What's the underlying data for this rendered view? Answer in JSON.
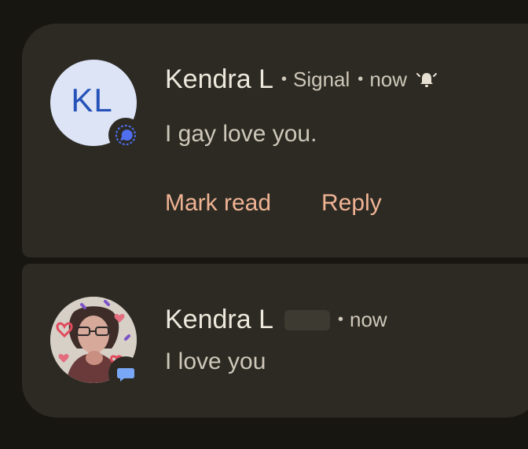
{
  "notifications": [
    {
      "avatar_initials": "KL",
      "sender": "Kendra L",
      "app": "Signal",
      "time": "now",
      "message": "I gay love you.",
      "actions": [
        "Mark read",
        "Reply"
      ],
      "icons": {
        "badge": "signal-chat-icon",
        "status": "alert-bell-icon"
      }
    },
    {
      "sender": "Kendra L",
      "time": "now",
      "message": "I love you",
      "icons": {
        "badge": "messages-chat-icon"
      }
    }
  ],
  "colors": {
    "background": "#181611",
    "card": "#2c2a23",
    "primary_text": "#efe9dd",
    "secondary_text": "#cfc8ba",
    "action_text": "#f0b394",
    "avatar_bg": "#dde4f6",
    "avatar_text": "#2452b8",
    "signal_blue": "#4f6ff0",
    "messages_blue": "#7aa7f5"
  }
}
